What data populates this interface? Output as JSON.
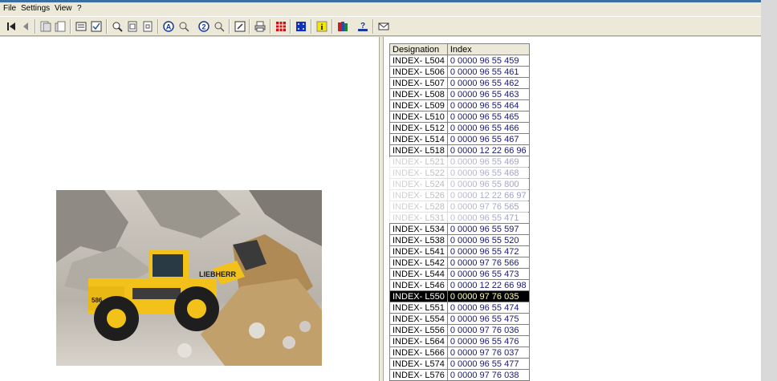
{
  "menu": {
    "file": "File",
    "settings": "Settings",
    "view": "View",
    "help": "?"
  },
  "toolbar": {
    "buttons": [
      {
        "name": "first-icon",
        "glyph": "⏮"
      },
      {
        "name": "back-icon",
        "glyph": "◀"
      },
      {
        "name": "prev-page-icon",
        "glyph": "▤"
      },
      {
        "name": "next-page-icon",
        "glyph": "▥"
      },
      {
        "name": "list-icon",
        "glyph": "≡"
      },
      {
        "name": "check-list-icon",
        "glyph": "☑"
      },
      {
        "name": "zoom-icon",
        "glyph": "⊕"
      },
      {
        "name": "page-icon",
        "glyph": "▢"
      },
      {
        "name": "page-two-icon",
        "glyph": "▢"
      },
      {
        "name": "search-a-icon",
        "glyph": "A"
      },
      {
        "name": "search-a-next-icon",
        "glyph": "↷"
      },
      {
        "name": "search-2-icon",
        "glyph": "2"
      },
      {
        "name": "search-2-next-icon",
        "glyph": "↷"
      },
      {
        "name": "edit-icon",
        "glyph": "✎"
      },
      {
        "name": "print-icon",
        "glyph": "⎙"
      },
      {
        "name": "grid-icon",
        "glyph": "▦"
      },
      {
        "name": "blue-grid-icon",
        "glyph": "▦"
      },
      {
        "name": "info-icon",
        "glyph": "i"
      },
      {
        "name": "books-icon",
        "glyph": "▥"
      },
      {
        "name": "help-icon",
        "glyph": "?"
      },
      {
        "name": "mail-icon",
        "glyph": "✉"
      }
    ]
  },
  "table": {
    "headers": {
      "designation": "Designation",
      "index": "Index"
    },
    "selected_row": 21,
    "rows": [
      {
        "designation": "INDEX- L504",
        "index": "0 0000 96 55 459"
      },
      {
        "designation": "INDEX- L506",
        "index": "0 0000 96 55 461"
      },
      {
        "designation": "INDEX- L507",
        "index": "0 0000 96 55 462"
      },
      {
        "designation": "INDEX- L508",
        "index": "0 0000 96 55 463"
      },
      {
        "designation": "INDEX- L509",
        "index": "0 0000 96 55 464"
      },
      {
        "designation": "INDEX- L510",
        "index": "0 0000 96 55 465"
      },
      {
        "designation": "INDEX- L512",
        "index": "0 0000 96 55 466"
      },
      {
        "designation": "INDEX- L514",
        "index": "0 0000 96 55 467"
      },
      {
        "designation": "INDEX- L518",
        "index": "0 0000 12 22 66 96"
      },
      {
        "designation": "INDEX- L521",
        "index": "0 0000 96 55 469"
      },
      {
        "designation": "INDEX- L522",
        "index": "0 0000 96 55 468"
      },
      {
        "designation": "INDEX- L524",
        "index": "0 0000 96 55 800"
      },
      {
        "designation": "INDEX- L526",
        "index": "0 0000 12 22 66 97"
      },
      {
        "designation": "INDEX- L528",
        "index": "0 0000 97 76 565"
      },
      {
        "designation": "INDEX- L531",
        "index": "0 0000 96 55 471"
      },
      {
        "designation": "INDEX- L534",
        "index": "0 0000 96 55 597"
      },
      {
        "designation": "INDEX- L538",
        "index": "0 0000 96 55 520"
      },
      {
        "designation": "INDEX- L541",
        "index": "0 0000 96 55 472"
      },
      {
        "designation": "INDEX- L542",
        "index": "0 0000 97 76 566"
      },
      {
        "designation": "INDEX- L544",
        "index": "0 0000 96 55 473"
      },
      {
        "designation": "INDEX- L546",
        "index": "0 0000 12 22 66 98"
      },
      {
        "designation": "INDEX- L550",
        "index": "0 0000 97 76 035"
      },
      {
        "designation": "INDEX- L551",
        "index": "0 0000 96 55 474"
      },
      {
        "designation": "INDEX- L554",
        "index": "0 0000 96 55 475"
      },
      {
        "designation": "INDEX- L556",
        "index": "0 0000 97 76 036"
      },
      {
        "designation": "INDEX- L564",
        "index": "0 0000 96 55 476"
      },
      {
        "designation": "INDEX- L566",
        "index": "0 0000 97 76 037"
      },
      {
        "designation": "INDEX- L574",
        "index": "0 0000 96 55 477"
      },
      {
        "designation": "INDEX- L576",
        "index": "0 0000 97 76 038"
      }
    ]
  },
  "photo": {
    "brand_text": "LIEBHERR",
    "model_text": "586"
  },
  "colors": {
    "accent": "#3a6ea5",
    "selection": "#000000",
    "machine_yellow": "#f2c21b"
  }
}
